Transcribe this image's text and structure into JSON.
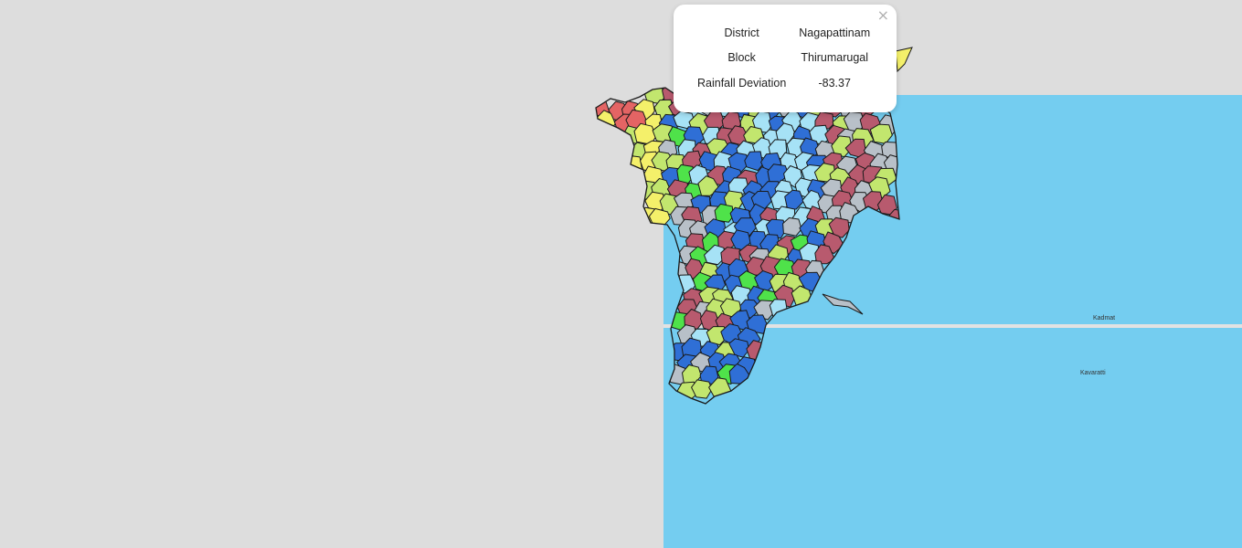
{
  "popup": {
    "close_glyph": "×",
    "rows": [
      {
        "label": "District",
        "value": "Nagapattinam"
      },
      {
        "label": "Block",
        "value": "Thirumarugal"
      },
      {
        "label": "Rainfall Deviation",
        "value": "-83.37"
      }
    ]
  },
  "places": {
    "label_1": "Kadmat",
    "label_2": "Kavaratti"
  },
  "colors": {
    "land_background": "#dddddd",
    "sea": "#74cdf0",
    "graticule": "#e2e2e2",
    "border": "#1a1a1a",
    "red": "#e46464",
    "maroon": "#b85a6e",
    "yellow": "#f4f06a",
    "light_green": "#c2e66e",
    "green": "#4fe24a",
    "light_blue": "#a6e2f6",
    "dark_blue": "#2f6fd6",
    "grey": "#b8c0c8"
  }
}
